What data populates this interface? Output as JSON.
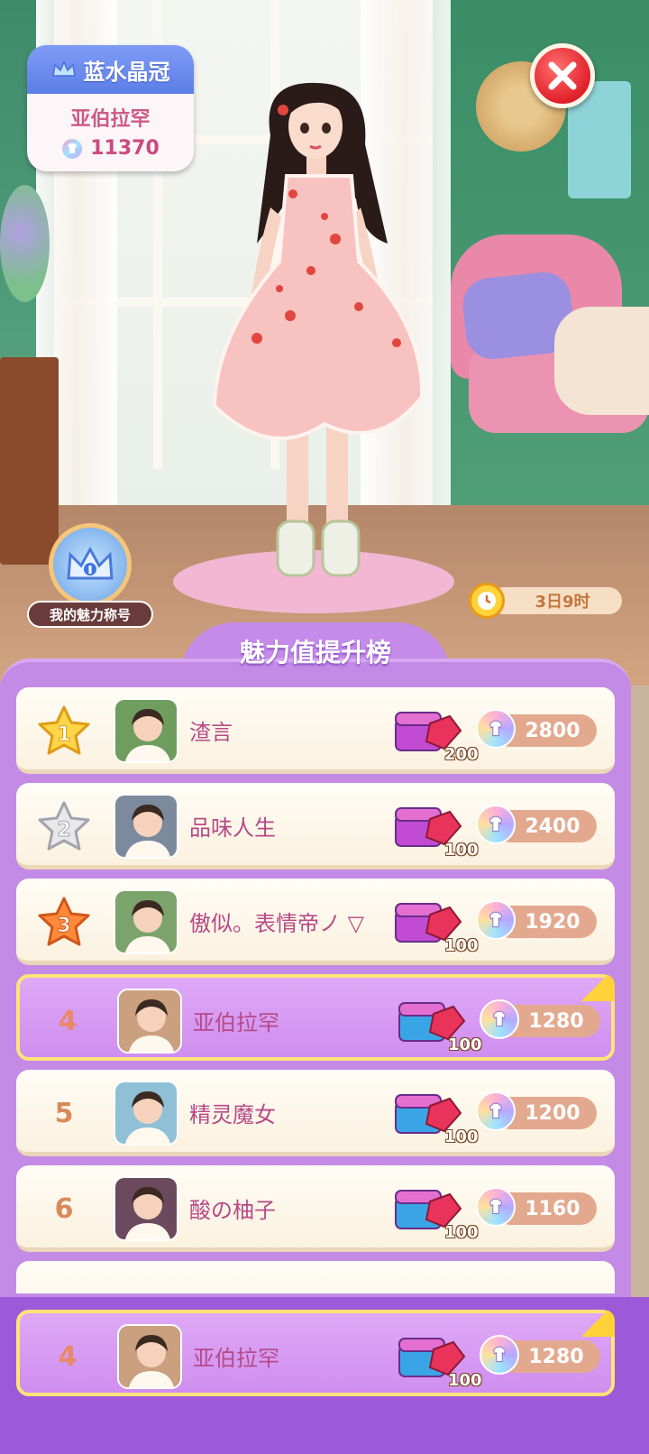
{
  "title_card": {
    "title": "蓝水晶冠",
    "player_name": "亚伯拉罕",
    "charm_value": "11370"
  },
  "charm_title_label": "我的魅力称号",
  "timer": "3日9时",
  "leaderboard": {
    "title": "魅力值提升榜",
    "rows": [
      {
        "rank": "1",
        "name": "渣言",
        "reward": "200",
        "score": "2800",
        "avatar_color": "#6f9d5e",
        "rank_style": "gold-star"
      },
      {
        "rank": "2",
        "name": "品味人生",
        "reward": "100",
        "score": "2400",
        "avatar_color": "#7c8a9e",
        "rank_style": "silver-star"
      },
      {
        "rank": "3",
        "name": "傲似。表情帝ノ ▽",
        "reward": "100",
        "score": "1920",
        "avatar_color": "#7ca36c",
        "rank_style": "bronze-star"
      },
      {
        "rank": "4",
        "name": "亚伯拉罕",
        "reward": "100",
        "score": "1280",
        "avatar_color": "#caa07e",
        "rank_style": "plain",
        "is_me": true
      },
      {
        "rank": "5",
        "name": "精灵魔女",
        "reward": "100",
        "score": "1200",
        "avatar_color": "#8fc0d6",
        "rank_style": "plain"
      },
      {
        "rank": "6",
        "name": "酸の柚子",
        "reward": "100",
        "score": "1160",
        "avatar_color": "#6b4a5e",
        "rank_style": "plain"
      }
    ],
    "my_row": {
      "rank": "4",
      "name": "亚伯拉罕",
      "reward": "100",
      "score": "1280",
      "avatar_color": "#caa07e"
    }
  },
  "colors": {
    "panel": "#c38ae6",
    "accent_pink": "#b64a86",
    "gold": "#ffd23a"
  }
}
